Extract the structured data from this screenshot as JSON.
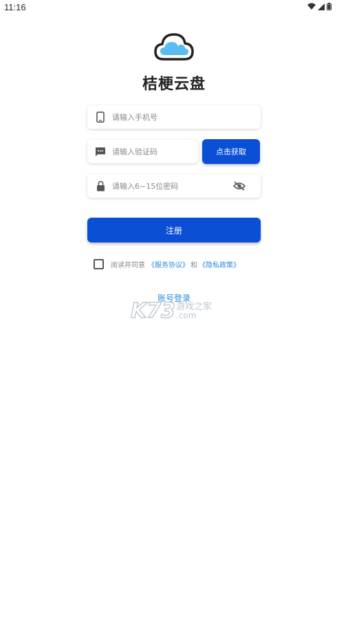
{
  "status_bar": {
    "time": "11:16"
  },
  "app": {
    "title": "桔梗云盘",
    "logo_icon": "cloud-icon"
  },
  "form": {
    "phone_placeholder": "请输入手机号",
    "code_placeholder": "请输入验证码",
    "get_code_label": "点击获取",
    "password_placeholder": "请输入6~15位密码",
    "register_label": "注册"
  },
  "agreement": {
    "prefix": "阅读并同意",
    "service_link": "《服务协议》",
    "and": "和",
    "privacy_link": "《隐私政策》"
  },
  "footer": {
    "account_login": "账号登录"
  },
  "watermark": {
    "text_main": "K73",
    "text_cn": "游戏之家",
    "text_com": ".com"
  },
  "colors": {
    "primary": "#0a4fd6",
    "link": "#2a8be0",
    "cloud": "#5bbcf0"
  }
}
